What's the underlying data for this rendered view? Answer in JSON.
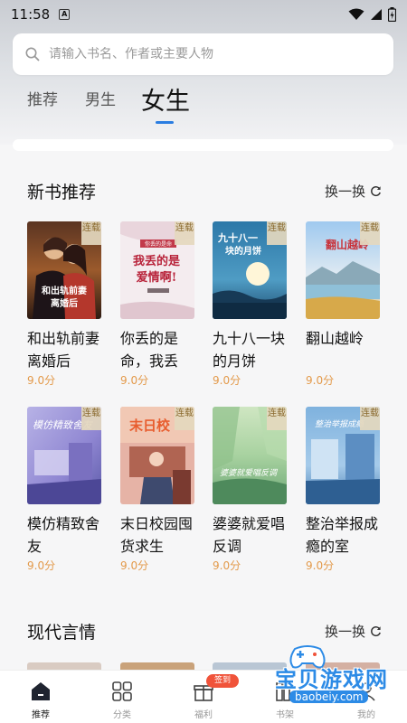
{
  "status_bar": {
    "time": "11:58",
    "notification_icon": "a-icon"
  },
  "search": {
    "placeholder": "请输入书名、作者或主要人物"
  },
  "tabs": [
    {
      "label": "推荐",
      "active": false
    },
    {
      "label": "男生",
      "active": false
    },
    {
      "label": "女生",
      "active": true
    }
  ],
  "sections": [
    {
      "title": "新书推荐",
      "refresh_label": "换一换",
      "books": [
        {
          "title": "和出轨前妻离婚后",
          "score": "9.0分",
          "tag": "连载",
          "cover_text": "和出轨前妻离婚后"
        },
        {
          "title": "你丢的是命，我丢",
          "score": "9.0分",
          "tag": "连载",
          "cover_text": "我丢的是爱情啊!"
        },
        {
          "title": "九十八一块的月饼",
          "score": "9.0分",
          "tag": "连载",
          "cover_text": "九十八一块的月饼"
        },
        {
          "title": "翻山越岭",
          "score": "9.0分",
          "tag": "连载",
          "cover_text": "翻山越岭"
        },
        {
          "title": "模仿精致舍友",
          "score": "9.0分",
          "tag": "连载",
          "cover_text": "模仿精致舍友"
        },
        {
          "title": "末日校园囤货求生",
          "score": "9.0分",
          "tag": "连载",
          "cover_text": "末日校园"
        },
        {
          "title": "婆婆就爱唱反调",
          "score": "9.0分",
          "tag": "连载",
          "cover_text": "婆婆就爱唱反调"
        },
        {
          "title": "整治举报成瘾的室",
          "score": "9.0分",
          "tag": "连载",
          "cover_text": "整治举报成瘾"
        }
      ]
    },
    {
      "title": "现代言情",
      "refresh_label": "换一换"
    }
  ],
  "bottom_nav": [
    {
      "label": "推荐",
      "icon": "home-icon",
      "active": true
    },
    {
      "label": "分类",
      "icon": "grid-icon",
      "active": false
    },
    {
      "label": "福利",
      "icon": "gift-icon",
      "active": false,
      "badge": "签到"
    },
    {
      "label": "书架",
      "icon": "bookshelf-icon",
      "active": false
    },
    {
      "label": "我的",
      "icon": "user-icon",
      "active": false
    }
  ],
  "watermark": {
    "text": "宝贝游戏网",
    "url": "baobeiy.com"
  },
  "colors": {
    "accent": "#2a7de1",
    "score": "#e39a4b",
    "tag_bg": "#e4d8be",
    "badge": "#f0533a"
  }
}
